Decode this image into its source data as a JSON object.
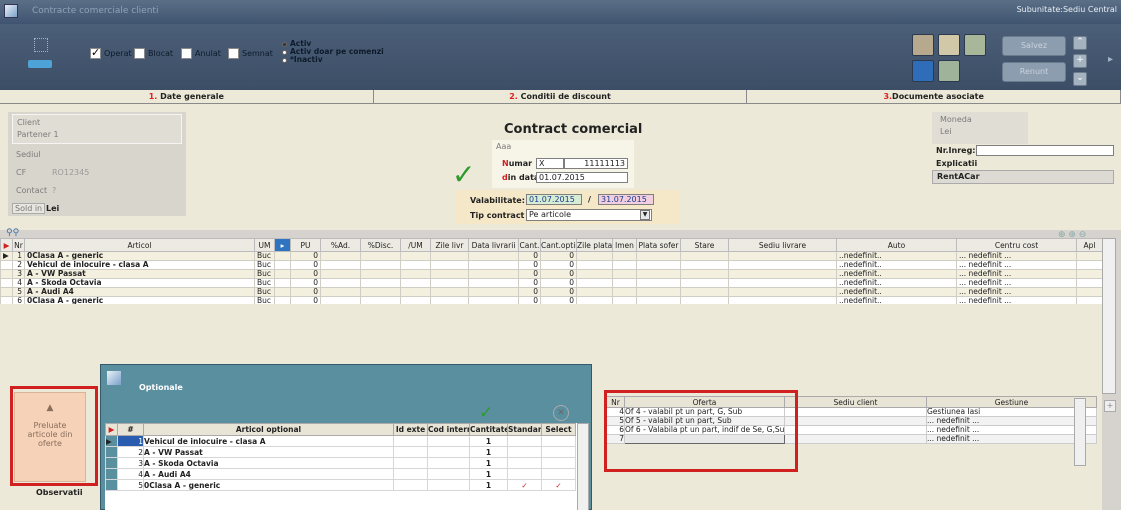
{
  "window": {
    "title": "Contracte comerciale clienti",
    "subunit": "Subunitate:Sediu Central"
  },
  "toolbar": {
    "checks": [
      {
        "label": "Operat",
        "checked": true
      },
      {
        "label": "Blocat",
        "checked": false
      },
      {
        "label": "Anulat",
        "checked": false
      },
      {
        "label": "Semnat",
        "checked": false
      }
    ],
    "radios": [
      {
        "label": "Activ",
        "checked": true
      },
      {
        "label": "Activ doar pe comenzi",
        "checked": false
      },
      {
        "label": "*Inactiv",
        "checked": false
      }
    ],
    "save_label": "Salvez",
    "cancel_label": "Renunt"
  },
  "tabs": [
    {
      "num": "1.",
      "label": " Date generale"
    },
    {
      "num": "2.",
      "label": " Conditii de discount"
    },
    {
      "num": "3.",
      "label": "Documente asociate"
    }
  ],
  "client": {
    "label": "Client",
    "partner": "Partener 1",
    "sediu_label": "Sediul",
    "cf_label": "CF",
    "cf_value": "RO12345",
    "contact_label": "Contact",
    "contact_value": "?",
    "sold_label": "Sold in",
    "sold_value": "Lei"
  },
  "contract": {
    "heading": "Contract comercial",
    "aaa": "Aaa",
    "numar_prefix": "N",
    "numar_label": "umar",
    "numar_series": "X",
    "numar_value": "11111113",
    "data_prefix": "d",
    "data_label": "in data",
    "data_value": "01.07.2015",
    "valabilitate_label": "Valabilitate:",
    "valid_from": "01.07.2015",
    "valid_sep": "/",
    "valid_to": "31.07.2015",
    "tip_label": "Tip contract",
    "tip_value": "Pe articole"
  },
  "moneda": {
    "label": "Moneda",
    "value": "Lei",
    "nr_inreg_label": "Nr.Inreg:",
    "explicatii_label": "Explicatii",
    "explicatii_value": "RentACar"
  },
  "grid": {
    "headers": [
      "Nr",
      "Articol",
      "UM",
      "",
      "PU",
      "%Ad.",
      "%Disc.",
      "/UM",
      "Zile livr",
      "Data livrarii",
      "Cant.",
      "Cant.optim",
      "Zile plata",
      "lmen",
      "Plata sofer",
      "Stare",
      "Sediu livrare",
      "Auto",
      "Centru cost",
      "Apl"
    ],
    "rows": [
      {
        "nr": "1",
        "articol": "0Clasa A - generic",
        "um": "Buc",
        "pu": "0",
        "cant": "0",
        "cant_optim": "0",
        "auto": "..nedefinit..",
        "cost": "... nedefinit ..."
      },
      {
        "nr": "2",
        "articol": "Vehicul de inlocuire - clasa A",
        "um": "Buc",
        "pu": "0",
        "cant": "0",
        "cant_optim": "0",
        "auto": "..nedefinit..",
        "cost": "... nedefinit ..."
      },
      {
        "nr": "3",
        "articol": "A - VW Passat",
        "um": "Buc",
        "pu": "0",
        "cant": "0",
        "cant_optim": "0",
        "auto": "..nedefinit..",
        "cost": "... nedefinit ..."
      },
      {
        "nr": "4",
        "articol": "A - Skoda Octavia",
        "um": "Buc",
        "pu": "0",
        "cant": "0",
        "cant_optim": "0",
        "auto": "..nedefinit..",
        "cost": "... nedefinit ..."
      },
      {
        "nr": "5",
        "articol": "A - Audi A4",
        "um": "Buc",
        "pu": "0",
        "cant": "0",
        "cant_optim": "0",
        "auto": "..nedefinit..",
        "cost": "... nedefinit ..."
      },
      {
        "nr": "6",
        "articol": "0Clasa A - generic",
        "um": "Buc",
        "pu": "0",
        "cant": "0",
        "cant_optim": "0",
        "auto": "..nedefinit..",
        "cost": "... nedefinit ..."
      }
    ]
  },
  "preluate": {
    "label": "Preluate articole din oferte",
    "below": "Observatii"
  },
  "optionale": {
    "title": "Optionale",
    "headers": [
      "#",
      "Articol optional",
      "Id exte",
      "Cod intern",
      "Cantitate",
      "Standard",
      "Select"
    ],
    "rows": [
      {
        "nr": "1",
        "articol": "Vehicul de inlocuire - clasa A",
        "cant": "1",
        "standard": false,
        "select": false
      },
      {
        "nr": "2",
        "articol": "A - VW Passat",
        "cant": "1",
        "standard": false,
        "select": false
      },
      {
        "nr": "3",
        "articol": "A - Skoda Octavia",
        "cant": "1",
        "standard": false,
        "select": false
      },
      {
        "nr": "4",
        "articol": "A - Audi A4",
        "cant": "1",
        "standard": false,
        "select": false
      },
      {
        "nr": "5",
        "articol": "0Clasa A - generic",
        "cant": "1",
        "standard": true,
        "select": true
      }
    ]
  },
  "oferte": {
    "headers": [
      "Nr",
      "Oferta",
      "Sediu client",
      "Gestiune"
    ],
    "rows": [
      {
        "nr": "4",
        "oferta": "Of 4 - valabil pt un part, G, Sub",
        "gestiune": "Gestiunea Iasi"
      },
      {
        "nr": "5",
        "oferta": "Of 5 - valabil pt un part, Sub",
        "gestiune": "... nedefinit ..."
      },
      {
        "nr": "6",
        "oferta": "Of 6 - Valabila pt un part, indif de Se, G,Su",
        "gestiune": "... nedefinit ..."
      },
      {
        "nr": "7",
        "oferta": "",
        "gestiune": "... nedefinit ..."
      }
    ]
  },
  "colors": {
    "accent_red": "#d02020",
    "green_check": "#2e9a2e",
    "titlebar": "#4a5f7a"
  }
}
